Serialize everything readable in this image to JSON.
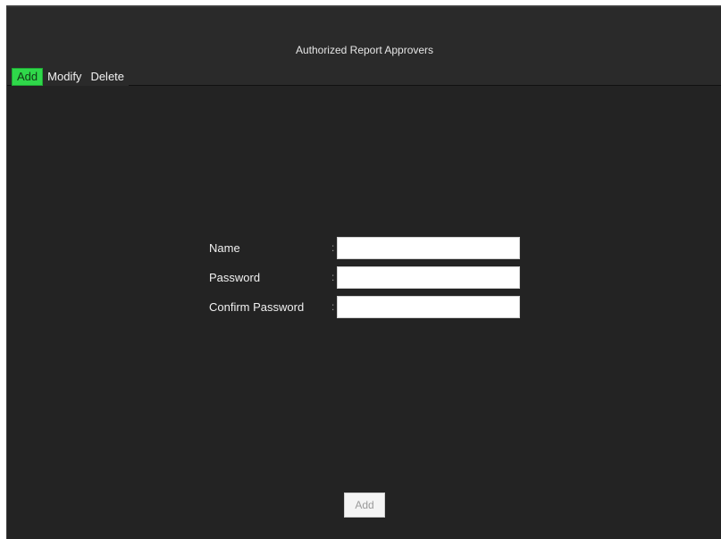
{
  "window": {
    "title": "Authorized Report Approvers"
  },
  "tabs": [
    {
      "label": "Add",
      "active": true
    },
    {
      "label": "Modify",
      "active": false
    },
    {
      "label": "Delete",
      "active": false
    }
  ],
  "form": {
    "fields": [
      {
        "label": "Name",
        "separator": ":",
        "value": "",
        "placeholder": ""
      },
      {
        "label": "Password",
        "separator": ":",
        "value": "",
        "placeholder": ""
      },
      {
        "label": "Confirm Password",
        "separator": ":",
        "value": "",
        "placeholder": ""
      }
    ],
    "submit_label": "Add"
  },
  "colors": {
    "background": "#232323",
    "active_tab": "#2fd84a",
    "text": "#f0f0f0"
  }
}
